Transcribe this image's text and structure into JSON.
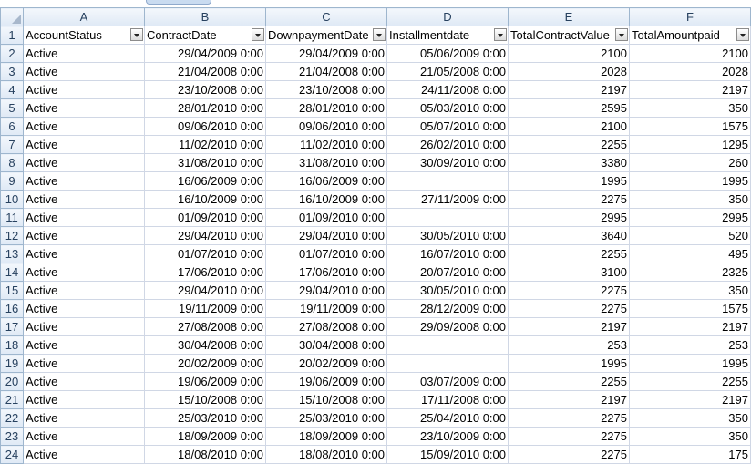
{
  "sheet": {
    "column_letters": [
      "A",
      "B",
      "C",
      "D",
      "E",
      "F"
    ],
    "headers": [
      "AccountStatus",
      "ContractDate",
      "DownpaymentDate",
      "Installmentdate",
      "TotalContractValue",
      "TotalAmountpaid"
    ],
    "header_row_number": "1",
    "rows": [
      {
        "n": "2",
        "a": "Active",
        "b": "29/04/2009 0:00",
        "c": "29/04/2009 0:00",
        "d": "05/06/2009 0:00",
        "e": "2100",
        "f": "2100"
      },
      {
        "n": "3",
        "a": "Active",
        "b": "21/04/2008 0:00",
        "c": "21/04/2008 0:00",
        "d": "21/05/2008 0:00",
        "e": "2028",
        "f": "2028"
      },
      {
        "n": "4",
        "a": "Active",
        "b": "23/10/2008 0:00",
        "c": "23/10/2008 0:00",
        "d": "24/11/2008 0:00",
        "e": "2197",
        "f": "2197"
      },
      {
        "n": "5",
        "a": "Active",
        "b": "28/01/2010 0:00",
        "c": "28/01/2010 0:00",
        "d": "05/03/2010 0:00",
        "e": "2595",
        "f": "350"
      },
      {
        "n": "6",
        "a": "Active",
        "b": "09/06/2010 0:00",
        "c": "09/06/2010 0:00",
        "d": "05/07/2010 0:00",
        "e": "2100",
        "f": "1575"
      },
      {
        "n": "7",
        "a": "Active",
        "b": "11/02/2010 0:00",
        "c": "11/02/2010 0:00",
        "d": "26/02/2010 0:00",
        "e": "2255",
        "f": "1295"
      },
      {
        "n": "8",
        "a": "Active",
        "b": "31/08/2010 0:00",
        "c": "31/08/2010 0:00",
        "d": "30/09/2010 0:00",
        "e": "3380",
        "f": "260"
      },
      {
        "n": "9",
        "a": "Active",
        "b": "16/06/2009 0:00",
        "c": "16/06/2009 0:00",
        "d": "",
        "e": "1995",
        "f": "1995"
      },
      {
        "n": "10",
        "a": "Active",
        "b": "16/10/2009 0:00",
        "c": "16/10/2009 0:00",
        "d": "27/11/2009 0:00",
        "e": "2275",
        "f": "350"
      },
      {
        "n": "11",
        "a": "Active",
        "b": "01/09/2010 0:00",
        "c": "01/09/2010 0:00",
        "d": "",
        "e": "2995",
        "f": "2995"
      },
      {
        "n": "12",
        "a": "Active",
        "b": "29/04/2010 0:00",
        "c": "29/04/2010 0:00",
        "d": "30/05/2010 0:00",
        "e": "3640",
        "f": "520"
      },
      {
        "n": "13",
        "a": "Active",
        "b": "01/07/2010 0:00",
        "c": "01/07/2010 0:00",
        "d": "16/07/2010 0:00",
        "e": "2255",
        "f": "495"
      },
      {
        "n": "14",
        "a": "Active",
        "b": "17/06/2010 0:00",
        "c": "17/06/2010 0:00",
        "d": "20/07/2010 0:00",
        "e": "3100",
        "f": "2325"
      },
      {
        "n": "15",
        "a": "Active",
        "b": "29/04/2010 0:00",
        "c": "29/04/2010 0:00",
        "d": "30/05/2010 0:00",
        "e": "2275",
        "f": "350"
      },
      {
        "n": "16",
        "a": "Active",
        "b": "19/11/2009 0:00",
        "c": "19/11/2009 0:00",
        "d": "28/12/2009 0:00",
        "e": "2275",
        "f": "1575"
      },
      {
        "n": "17",
        "a": "Active",
        "b": "27/08/2008 0:00",
        "c": "27/08/2008 0:00",
        "d": "29/09/2008 0:00",
        "e": "2197",
        "f": "2197"
      },
      {
        "n": "18",
        "a": "Active",
        "b": "30/04/2008 0:00",
        "c": "30/04/2008 0:00",
        "d": "",
        "e": "253",
        "f": "253"
      },
      {
        "n": "19",
        "a": "Active",
        "b": "20/02/2009 0:00",
        "c": "20/02/2009 0:00",
        "d": "",
        "e": "1995",
        "f": "1995"
      },
      {
        "n": "20",
        "a": "Active",
        "b": "19/06/2009 0:00",
        "c": "19/06/2009 0:00",
        "d": "03/07/2009 0:00",
        "e": "2255",
        "f": "2255"
      },
      {
        "n": "21",
        "a": "Active",
        "b": "15/10/2008 0:00",
        "c": "15/10/2008 0:00",
        "d": "17/11/2008 0:00",
        "e": "2197",
        "f": "2197"
      },
      {
        "n": "22",
        "a": "Active",
        "b": "25/03/2010 0:00",
        "c": "25/03/2010 0:00",
        "d": "25/04/2010 0:00",
        "e": "2275",
        "f": "350"
      },
      {
        "n": "23",
        "a": "Active",
        "b": "18/09/2009 0:00",
        "c": "18/09/2009 0:00",
        "d": "23/10/2009 0:00",
        "e": "2275",
        "f": "350"
      },
      {
        "n": "24",
        "a": "Active",
        "b": "18/08/2010 0:00",
        "c": "18/08/2010 0:00",
        "d": "15/09/2010 0:00",
        "e": "2275",
        "f": "175"
      }
    ]
  },
  "colors": {
    "gridline": "#d0d7e5",
    "header_bg": "#dfe9f5",
    "header_text": "#27415f"
  }
}
